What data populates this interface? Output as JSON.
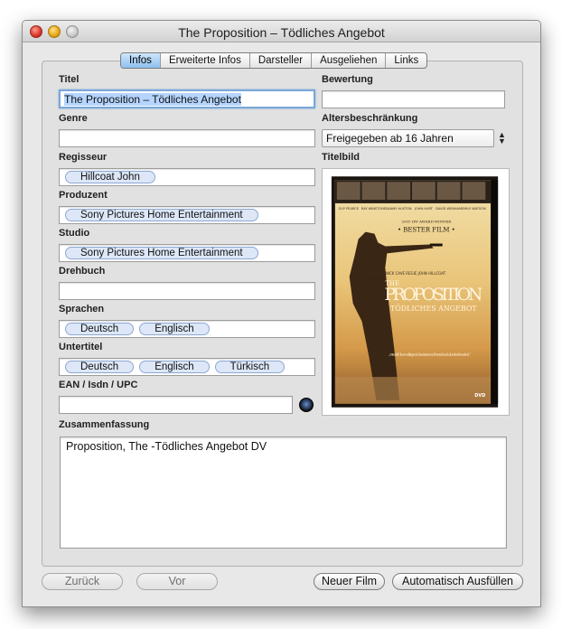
{
  "window": {
    "title": "The Proposition – Tödliches Angebot"
  },
  "tabs": [
    {
      "label": "Infos",
      "active": true
    },
    {
      "label": "Erweiterte Infos",
      "active": false
    },
    {
      "label": "Darsteller",
      "active": false
    },
    {
      "label": "Ausgeliehen",
      "active": false
    },
    {
      "label": "Links",
      "active": false
    }
  ],
  "form": {
    "titel": {
      "label": "Titel",
      "value": "The Proposition – Tödliches Angebot"
    },
    "bewertung": {
      "label": "Bewertung",
      "value": ""
    },
    "genre": {
      "label": "Genre",
      "value": ""
    },
    "altersbeschraenkung": {
      "label": "Altersbeschränkung",
      "value": "Freigegeben ab 16 Jahren"
    },
    "regisseur": {
      "label": "Regisseur",
      "tokens": [
        "Hillcoat John"
      ]
    },
    "titelbild": {
      "label": "Titelbild"
    },
    "produzent": {
      "label": "Produzent",
      "tokens": [
        "Sony Pictures Home Entertainment"
      ]
    },
    "studio": {
      "label": "Studio",
      "tokens": [
        "Sony Pictures Home Entertainment"
      ]
    },
    "drehbuch": {
      "label": "Drehbuch",
      "value": ""
    },
    "sprachen": {
      "label": "Sprachen",
      "tokens": [
        "Deutsch",
        "Englisch"
      ]
    },
    "untertitel": {
      "label": "Untertitel",
      "tokens": [
        "Deutsch",
        "Englisch",
        "Türkisch"
      ]
    },
    "ean": {
      "label": "EAN / Isdn / UPC",
      "value": ""
    },
    "zusammenfassung": {
      "label": "Zusammenfassung",
      "value": "Proposition, The -Tödliches Angebot DV"
    }
  },
  "poster": {
    "actors": [
      "GUY PEARCE",
      "RAY WINSTONE",
      "DANNY HUSTON",
      "JOHN HURT",
      "DAVID WENHAM",
      "EMILY WATSON"
    ],
    "award_line": "2005 IFF AWARD-WINNER",
    "award": "• BESTER FILM •",
    "credits": "DREHBUCH NICK CAVE   REGIE JOHN HILLCOAT",
    "title_the": "THE",
    "title_main": "PROPOSITION",
    "title_sub": "TÖDLICHES ANGEBOT",
    "quote": "„Visuell überwältigend, faszinierend brutal und absolut fesselnd.“",
    "logo": "DVD"
  },
  "buttons": {
    "back": "Zurück",
    "forward": "Vor",
    "new_film": "Neuer Film",
    "auto_fill": "Automatisch Ausfüllen"
  },
  "colors": {
    "accent": "#7aa7d8",
    "token_bg": "#dde7f7",
    "token_border": "#8ea8d3",
    "tab_active": "#8ec0ef"
  }
}
